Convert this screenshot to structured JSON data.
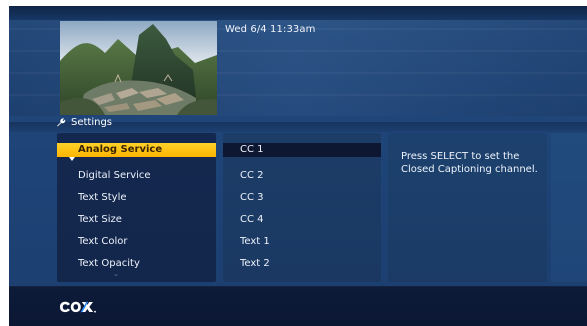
{
  "header": {
    "datetime": "Wed 6/4  11:33am",
    "section_title": "Settings"
  },
  "menu": {
    "items": [
      {
        "label": "Analog Service",
        "selected": true
      },
      {
        "label": "Digital Service",
        "selected": false
      },
      {
        "label": "Text Style",
        "selected": false
      },
      {
        "label": "Text Size",
        "selected": false
      },
      {
        "label": "Text Color",
        "selected": false
      },
      {
        "label": "Text Opacity",
        "selected": false
      }
    ],
    "scroll_icon": "chevron-down-icon"
  },
  "options": {
    "items": [
      {
        "label": "CC 1",
        "selected": true
      },
      {
        "label": "CC 2",
        "selected": false
      },
      {
        "label": "CC 3",
        "selected": false
      },
      {
        "label": "CC 4",
        "selected": false
      },
      {
        "label": "Text 1",
        "selected": false
      },
      {
        "label": "Text 2",
        "selected": false
      }
    ]
  },
  "help": {
    "text": "Press SELECT to set the Closed Captioning channel."
  },
  "brand": {
    "logo": "cox-logo",
    "accent_color": "#ffc21a",
    "background_color": "#1f4579"
  }
}
